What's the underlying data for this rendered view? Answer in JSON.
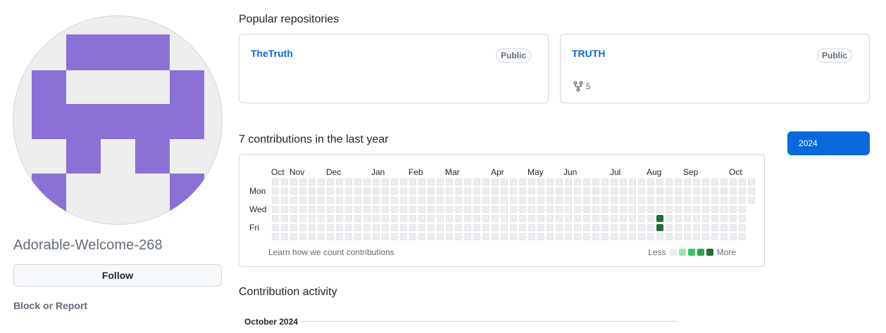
{
  "profile": {
    "username": "Adorable-Welcome-268",
    "follow_label": "Follow",
    "block_label": "Block or Report",
    "avatar_color": "#8b71d6",
    "avatar_bg": "#eeeeee"
  },
  "popular": {
    "title": "Popular repositories",
    "repos": [
      {
        "name": "TheTruth",
        "visibility": "Public",
        "forks": ""
      },
      {
        "name": "TRUTH",
        "visibility": "Public",
        "forks": "5"
      }
    ]
  },
  "contributions": {
    "title": "7 contributions in the last year",
    "year": "2024",
    "months": [
      "Oct",
      "Nov",
      "Dec",
      "Jan",
      "Feb",
      "Mar",
      "Apr",
      "May",
      "Jun",
      "Jul",
      "Aug",
      "Sep",
      "Oct"
    ],
    "days": [
      "Mon",
      "Wed",
      "Fri"
    ],
    "learn_text": "Learn how we count contributions",
    "legend_less": "Less",
    "legend_more": "More",
    "levels": [
      "#ebedf0",
      "#9be9a8",
      "#40c463",
      "#30a14e",
      "#216e39"
    ],
    "active_cells": [
      {
        "week": 42,
        "day": 4,
        "level": 4
      },
      {
        "week": 42,
        "day": 5,
        "level": 4
      }
    ]
  },
  "activity": {
    "title": "Contribution activity",
    "month": "October 2024"
  }
}
